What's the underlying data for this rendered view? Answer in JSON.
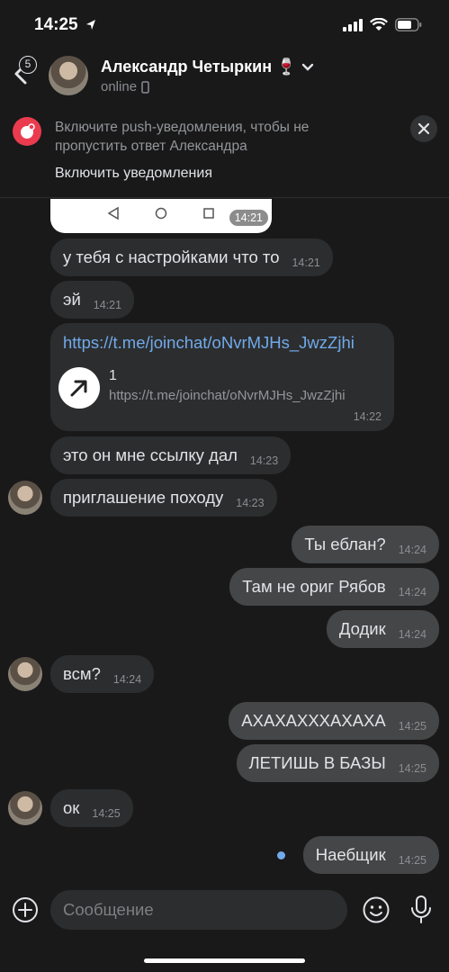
{
  "status_bar": {
    "time": "14:25"
  },
  "header": {
    "back_badge": "5",
    "name": "Александр Четыркин 🍷",
    "status": "online"
  },
  "banner": {
    "text": "Включите push-уведомления, чтобы не пропустить ответ Александра",
    "action": "Включить уведомления"
  },
  "messages": [
    {
      "dir": "in",
      "text": "",
      "time": "14:21",
      "kind": "screenshot"
    },
    {
      "dir": "in",
      "text": "у тебя с настройками что то",
      "time": "14:21"
    },
    {
      "dir": "in",
      "text": "эй",
      "time": "14:21"
    },
    {
      "dir": "in",
      "kind": "link",
      "url": "https://t.me/joinchat/oNvrMJHs_JwzZjhi",
      "preview_title": "1",
      "preview_url": "https://t.me/joinchat/oNvrMJHs_JwzZjhi",
      "time": "14:22"
    },
    {
      "dir": "in",
      "text": "это он мне ссылку дал",
      "time": "14:23"
    },
    {
      "dir": "in",
      "text": "приглашение походу",
      "time": "14:23"
    },
    {
      "dir": "out",
      "text": "Ты еблан?",
      "time": "14:24"
    },
    {
      "dir": "out",
      "text": "Там не ориг Рябов",
      "time": "14:24"
    },
    {
      "dir": "out",
      "text": "Додик",
      "time": "14:24"
    },
    {
      "dir": "in",
      "text": "всм?",
      "time": "14:24"
    },
    {
      "dir": "out",
      "text": "АХАХАХХХАХАХА",
      "time": "14:25"
    },
    {
      "dir": "out",
      "text": "ЛЕТИШЬ В БАЗЫ",
      "time": "14:25"
    },
    {
      "dir": "in",
      "text": "ок",
      "time": "14:25"
    },
    {
      "dir": "out",
      "text": "Наебщик",
      "time": "14:25",
      "unread": true
    }
  ],
  "composer": {
    "placeholder": "Сообщение"
  }
}
